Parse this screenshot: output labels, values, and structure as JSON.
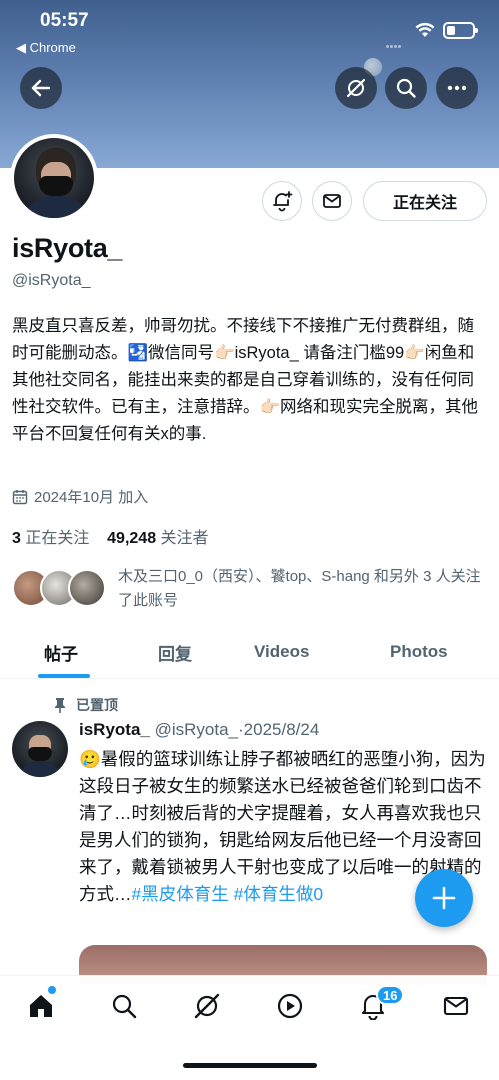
{
  "status_bar": {
    "time": "05:57",
    "back_app": "◀ Chrome"
  },
  "header_icons": [
    "back-arrow-icon",
    "grok-icon",
    "search-icon",
    "more-icon"
  ],
  "profile": {
    "display_name": "isRyota_",
    "handle": "@isRyota_",
    "following_button": "正在关注",
    "bio": "黑皮直只喜反差，帅哥勿扰。不接线下不接推广无付费群组，随时可能删动态。🛂微信同号👉🏻isRyota_ 请备注门槛99👉🏻闲鱼和其他社交同名，能挂出来卖的都是自己穿着训练的，没有任何同性社交软件。已有主，注意措辞。👉🏻网络和现实完全脱离，其他平台不回复任何有关x的事.",
    "joined": "2024年10月 加入",
    "following_count": "3",
    "following_label": "正在关注",
    "followers_count": "49,248",
    "followers_label": "关注者",
    "followed_by": "木及三口0_0（西安）、饕top、S-hang 和另外 3 人关注了此账号"
  },
  "tabs": [
    {
      "label": "帖子"
    },
    {
      "label": "回复"
    },
    {
      "label": "Videos"
    },
    {
      "label": "Photos"
    }
  ],
  "post": {
    "pinned_label": "已置顶",
    "author_name": "isRyota_",
    "author_handle": "@isRyota_",
    "date": "·2025/8/24",
    "text": "🥲暑假的篮球训练让脖子都被晒红的恶堕小狗，因为这段日子被女生的频繁送水已经被爸爸们轮到口齿不清了…时刻被后背的犬字提醒着，女人再喜欢我也只是男人们的锁狗，钥匙给网友后他已经一个月没寄回来了，戴着锁被男人干射也变成了以后唯一的射精的方式…",
    "hashtag1": "#黑皮体育生",
    "hashtag2": "#体育生做0"
  },
  "bottom_nav": {
    "items": [
      "home-icon",
      "search-icon",
      "grok-icon",
      "video-icon",
      "notifications-icon",
      "messages-icon"
    ],
    "notification_badge": "16"
  },
  "colors": {
    "accent": "#1d9bf0",
    "text": "#0f1419",
    "secondary": "#536471",
    "border": "#cfd9de"
  }
}
